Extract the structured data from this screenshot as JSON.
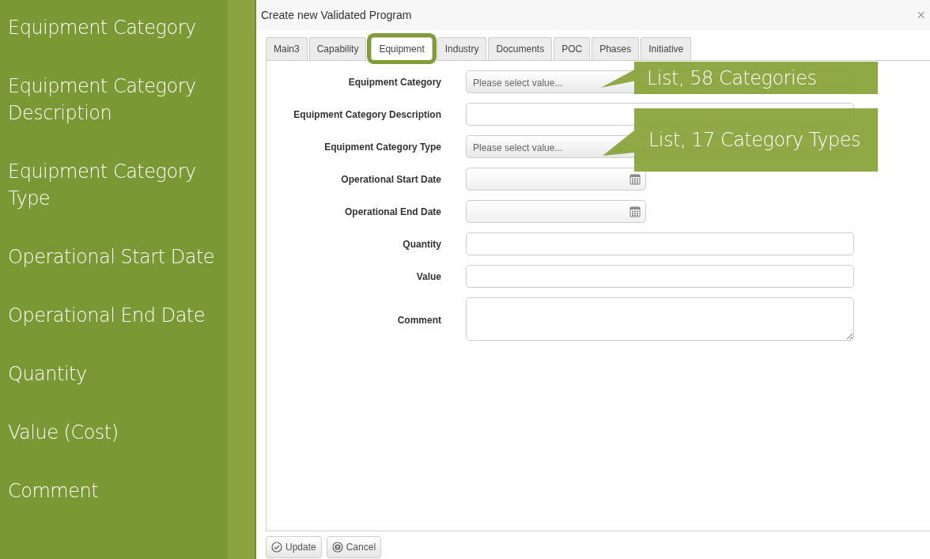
{
  "sidebar": {
    "labels": [
      {
        "text": "Equipment Category"
      },
      {
        "text": "Equipment Category Description"
      },
      {
        "text": "Equipment Category Type"
      },
      {
        "text": "Operational Start Date"
      },
      {
        "text": "Operational End Date"
      },
      {
        "text": "Quantity"
      },
      {
        "text": "Value (Cost)"
      },
      {
        "text": "Comment"
      }
    ]
  },
  "dialog": {
    "title": "Create new Validated Program",
    "close": "×",
    "tabs": [
      {
        "label": "Main3",
        "selected": false
      },
      {
        "label": "Capability",
        "selected": false
      },
      {
        "label": "Equipment",
        "selected": true
      },
      {
        "label": "Industry",
        "selected": false
      },
      {
        "label": "Documents",
        "selected": false
      },
      {
        "label": "POC",
        "selected": false
      },
      {
        "label": "Phases",
        "selected": false
      },
      {
        "label": "Initiative",
        "selected": false
      }
    ],
    "fields": [
      {
        "label": "Equipment Category",
        "kind": "select",
        "placeholder": "Please select value..."
      },
      {
        "label": "Equipment Category Description",
        "kind": "text"
      },
      {
        "label": "Equipment Category Type",
        "kind": "select",
        "placeholder": "Please select value..."
      },
      {
        "label": "Operational Start Date",
        "kind": "date"
      },
      {
        "label": "Operational End Date",
        "kind": "date"
      },
      {
        "label": "Quantity",
        "kind": "text"
      },
      {
        "label": "Value",
        "kind": "text"
      },
      {
        "label": "Comment",
        "kind": "textarea"
      }
    ],
    "buttons": [
      {
        "label": "Update",
        "kind": "confirm"
      },
      {
        "label": "Cancel",
        "kind": "cancel"
      }
    ]
  },
  "callouts": [
    {
      "text": "List, 58 Categories"
    },
    {
      "text": "List, 17 Category Types"
    }
  ]
}
